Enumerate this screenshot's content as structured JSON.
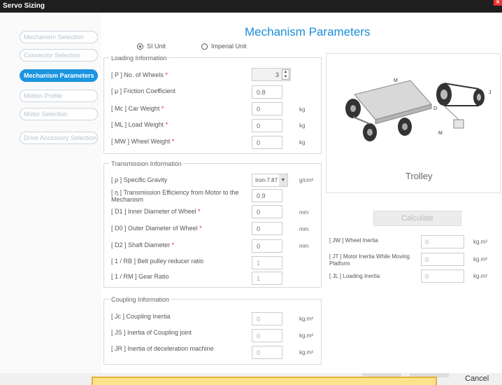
{
  "window": {
    "title": "Servo Sizing"
  },
  "sidebar": {
    "items": [
      {
        "label": "Mechanism Selection"
      },
      {
        "label": "Connector Selection"
      },
      {
        "label": "Mechanism Parameters"
      },
      {
        "label": "Motion Profile"
      },
      {
        "label": "Motor Selection"
      },
      {
        "label": "Drive Accessory Selection"
      }
    ],
    "active_index": 2
  },
  "page_title": "Mechanism Parameters",
  "units": {
    "si_label": "SI Unit",
    "imperial_label": "Imperial Unit",
    "selected": "SI Unit"
  },
  "loading": {
    "title": "Loading Information",
    "rows": [
      {
        "label": "[ P ] No. of Wheels",
        "required": true,
        "value": "3",
        "unit": ""
      },
      {
        "label": "[ μ ] Friction Coefficient",
        "required": false,
        "value": "0.8",
        "unit": ""
      },
      {
        "label": "[ Mc ] Car Weight",
        "required": true,
        "value": "0",
        "unit": "kg"
      },
      {
        "label": "[ ML ] Load Weight",
        "required": true,
        "value": "0",
        "unit": "kg"
      },
      {
        "label": "[ MW ] Wheel Weight",
        "required": true,
        "value": "0",
        "unit": "kg"
      }
    ]
  },
  "transmission": {
    "title": "Transmission Information",
    "specific_gravity": {
      "label": "[ ρ ] Specific Gravity",
      "value": "Iron-7.87",
      "unit": "g/cm³"
    },
    "rows": [
      {
        "label": "[ η ] Transmission Efficiency from Motor to the Mechanism",
        "required": false,
        "value": "0.9",
        "unit": ""
      },
      {
        "label": "[ D1 ] Inner Diameter of Wheel",
        "required": true,
        "value": "0",
        "unit": "mm"
      },
      {
        "label": "[ D0 ] Outer Diameter of Wheel",
        "required": true,
        "value": "0",
        "unit": "mm"
      },
      {
        "label": "[ D2 ] Shaft Diameter",
        "required": true,
        "value": "0",
        "unit": "mm"
      },
      {
        "label": "[ 1 / RB ] Belt pulley reducer ratio",
        "required": false,
        "value": "1",
        "unit": ""
      },
      {
        "label": "[ 1 / RM ] Gear Ratio",
        "required": false,
        "value": "1",
        "unit": ""
      }
    ]
  },
  "coupling": {
    "title": "Coupling Information",
    "rows": [
      {
        "label": "[ Jc ] Coupling Inertia",
        "value": "0",
        "unit": "kg.m²"
      },
      {
        "label": "[ JS ] Inertia of Coupling joint",
        "value": "0",
        "unit": "kg.m²"
      },
      {
        "label": "[ JR ] Inertia of deceleration machine",
        "value": "0",
        "unit": "kg.m²"
      }
    ]
  },
  "image_panel": {
    "caption": "Trolley"
  },
  "calculate_label": "Calculate",
  "results": [
    {
      "label": "[ JW ] Wheel Inertia",
      "value": "0",
      "unit": "kg.m²"
    },
    {
      "label": "[ JT ] Motor Inertia While Moving Platform",
      "value": "0",
      "unit": "kg.m²"
    },
    {
      "label": "[ JL ] Loading Inertia",
      "value": "0",
      "unit": "kg.m²"
    }
  ],
  "footer": {
    "cancel_label": "Cancel"
  },
  "colors": {
    "accent": "#1b95e0",
    "required": "#e03030",
    "highlight": "#fde38a"
  }
}
